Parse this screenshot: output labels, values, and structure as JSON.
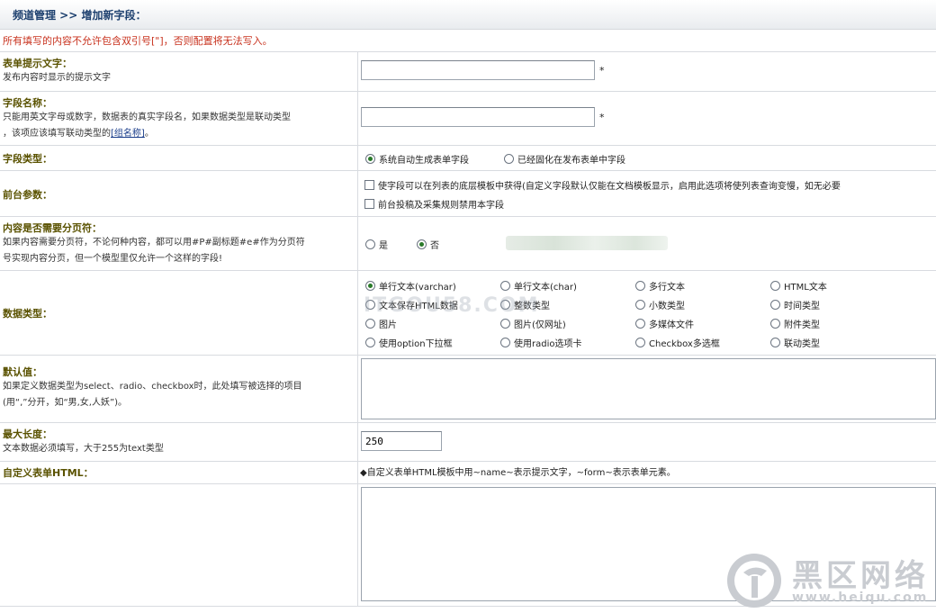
{
  "header": {
    "breadcrumb": "频道管理 >> 增加新字段："
  },
  "warning": "所有填写的内容不允许包含双引号[\"]，否则配置将无法写入。",
  "form": {
    "hint_text": {
      "title": "表单提示文字：",
      "desc": "发布内容时显示的提示文字",
      "value": "",
      "required_mark": "*"
    },
    "field_name": {
      "title": "字段名称：",
      "desc_line1": "只能用英文字母或数字，数据表的真实字段名，如果数据类型是联动类型",
      "desc_line2_prefix": "，该项应该填写联动类型的",
      "desc_link": "[组名称]",
      "desc_line2_suffix": "。",
      "value": "",
      "required_mark": "*"
    },
    "field_type": {
      "title": "字段类型：",
      "options": [
        {
          "label": "系统自动生成表单字段",
          "checked": true
        },
        {
          "label": "已经固化在发布表单中字段",
          "checked": false
        }
      ]
    },
    "front_params": {
      "title": "前台参数：",
      "options": [
        {
          "label": "使字段可以在列表的底层模板中获得(自定义字段默认仅能在文档模板显示，启用此选项将使列表查询变慢，如无必要",
          "checked": false
        },
        {
          "label": "前台投稿及采集规则禁用本字段",
          "checked": false
        }
      ]
    },
    "pagination": {
      "title": "内容是否需要分页符：",
      "desc_line1": "如果内容需要分页符，不论何种内容，都可以用#P#副标题#e#作为分页符",
      "desc_line2": "号实现内容分页，但一个模型里仅允许一个这样的字段!",
      "options": [
        {
          "label": "是",
          "checked": false
        },
        {
          "label": "否",
          "checked": true
        }
      ]
    },
    "data_type": {
      "title": "数据类型：",
      "options": [
        {
          "label": "单行文本(varchar)",
          "checked": true
        },
        {
          "label": "单行文本(char)",
          "checked": false
        },
        {
          "label": "多行文本",
          "checked": false
        },
        {
          "label": "HTML文本",
          "checked": false
        },
        {
          "label": "文本保存HTML数据",
          "checked": false
        },
        {
          "label": "整数类型",
          "checked": false
        },
        {
          "label": "小数类型",
          "checked": false
        },
        {
          "label": "时间类型",
          "checked": false
        },
        {
          "label": "图片",
          "checked": false
        },
        {
          "label": "图片(仅网址)",
          "checked": false
        },
        {
          "label": "多媒体文件",
          "checked": false
        },
        {
          "label": "附件类型",
          "checked": false
        },
        {
          "label": "使用option下拉框",
          "checked": false
        },
        {
          "label": "使用radio选项卡",
          "checked": false
        },
        {
          "label": "Checkbox多选框",
          "checked": false
        },
        {
          "label": "联动类型",
          "checked": false
        }
      ]
    },
    "default_value": {
      "title": "默认值：",
      "desc_line1": "如果定义数据类型为select、radio、checkbox时，此处填写被选择的项目",
      "desc_line2": "(用“,”分开，如“男,女,人妖”)。",
      "value": ""
    },
    "max_length": {
      "title": "最大长度：",
      "desc": "文本数据必须填写，大于255为text类型",
      "value": "250"
    },
    "custom_html": {
      "title": "自定义表单HTML：",
      "note": "◆自定义表单HTML模板中用~name~表示提示文字，~form~表示表单元素。",
      "value": ""
    }
  },
  "watermarks": {
    "site_text": "ITGOU58.COM",
    "logo_cn": "黑区网络",
    "logo_url": "www.heiqu.com"
  }
}
